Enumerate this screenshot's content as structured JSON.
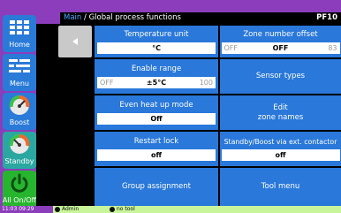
{
  "header": {
    "breadcrumb_root": "Main",
    "breadcrumb_sep": " / ",
    "title": "Global process functions",
    "page_id": "PF10"
  },
  "sidebar": {
    "items": [
      {
        "label": "Home",
        "icon": "home-grid-icon"
      },
      {
        "label": "Menu",
        "icon": "menu-list-icon"
      },
      {
        "label": "Boost",
        "icon": "boost-gauge-icon"
      },
      {
        "label": "Standby",
        "icon": "standby-gauge-icon"
      },
      {
        "label": "All On/Off",
        "icon": "power-icon"
      }
    ]
  },
  "tiles": {
    "temperature_unit": {
      "label": "Temperature unit",
      "value": "°C"
    },
    "zone_number_offset": {
      "label": "Zone number offset",
      "value": "OFF",
      "min": "OFF",
      "max": "83"
    },
    "enable_range": {
      "label": "Enable range",
      "value": "±5°C",
      "min": "OFF",
      "max": "100"
    },
    "sensor_types": {
      "label": "Sensor types"
    },
    "even_heat_up": {
      "label": "Even heat up mode",
      "value": "Off"
    },
    "edit_zone_names": {
      "label_line1": "Edit",
      "label_line2": "zone names"
    },
    "restart_lock": {
      "label": "Restart lock",
      "value": "off"
    },
    "standby_boost": {
      "label": "Standby/Boost via ext. contactor",
      "value": "off"
    },
    "group_assignment": {
      "label": "Group assignment"
    },
    "tool_menu": {
      "label": "Tool menu"
    }
  },
  "footer": {
    "datetime": "11:03 09:29",
    "user": "Admin",
    "tool": "no tool"
  },
  "colors": {
    "frame": "#8b3dbb",
    "tile": "#2978da",
    "footer": "#c8f59a",
    "sidebar_blue": "#2a7ad8",
    "sidebar_teal": "#2aa7a0",
    "sidebar_green": "#27b52f"
  }
}
